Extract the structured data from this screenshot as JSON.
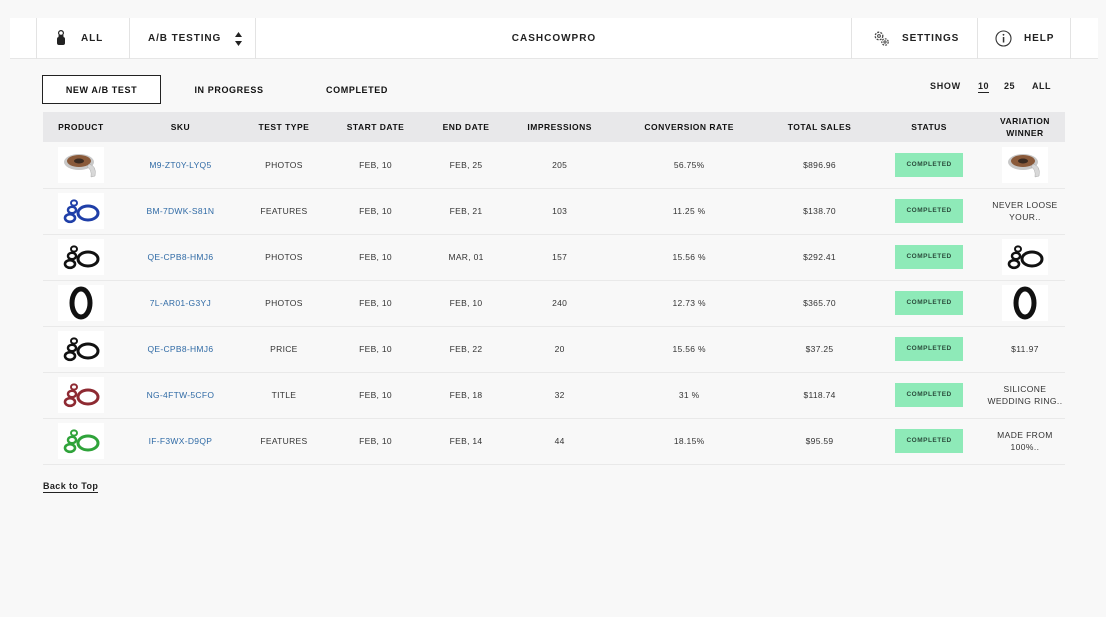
{
  "topbar": {
    "all_label": "ALL",
    "ab_label": "A/B TESTING",
    "title": "CASHCOWPRO",
    "settings_label": "SETTINGS",
    "help_label": "HELP"
  },
  "tabs": [
    "NEW A/B TEST",
    "IN PROGRESS",
    "COMPLETED"
  ],
  "show": {
    "label": "SHOW",
    "options": [
      "10",
      "25",
      "ALL"
    ],
    "selected": "10"
  },
  "table": {
    "headers": {
      "product": "PRODUCT",
      "sku": "SKU",
      "test_type": "TEST TYPE",
      "start_date": "START DATE",
      "end_date": "END DATE",
      "impressions": "IMPRESSIONS",
      "conversion_rate": "CONVERSION RATE",
      "total_sales": "TOTAL SALES",
      "status": "STATUS",
      "variation_winner": "VARIATION WINNER"
    },
    "rows": [
      {
        "product_icon": "tape-roll-icon",
        "sku": "M9-ZT0Y-LYQ5",
        "test_type": "PHOTOS",
        "start_date": "FEB, 10",
        "end_date": "FEB, 25",
        "impressions": "205",
        "conversion_rate": "56.75%",
        "total_sales": "$896.96",
        "status": "COMPLETED",
        "winner": "",
        "winner_icon": "tape-roll-icon"
      },
      {
        "product_icon": "blue-rings-icon",
        "sku": "BM-7DWK-S81N",
        "test_type": "FEATURES",
        "start_date": "FEB, 10",
        "end_date": "FEB, 21",
        "impressions": "103",
        "conversion_rate": "11.25 %",
        "total_sales": "$138.70",
        "status": "COMPLETED",
        "winner": "NEVER LOOSE YOUR.."
      },
      {
        "product_icon": "black-rings-icon",
        "sku": "QE-CPB8-HMJ6",
        "test_type": "PHOTOS",
        "start_date": "FEB, 10",
        "end_date": "MAR, 01",
        "impressions": "157",
        "conversion_rate": "15.56 %",
        "total_sales": "$292.41",
        "status": "COMPLETED",
        "winner": "",
        "winner_icon": "black-rings-icon"
      },
      {
        "product_icon": "black-ring-single-icon",
        "sku": "7L-AR01-G3YJ",
        "test_type": "PHOTOS",
        "start_date": "FEB, 10",
        "end_date": "FEB, 10",
        "impressions": "240",
        "conversion_rate": "12.73 %",
        "total_sales": "$365.70",
        "status": "COMPLETED",
        "winner": "",
        "winner_icon": "black-ring-single-icon"
      },
      {
        "product_icon": "black-rings-icon",
        "sku": "QE-CPB8-HMJ6",
        "test_type": "PRICE",
        "start_date": "FEB, 10",
        "end_date": "FEB, 22",
        "impressions": "20",
        "conversion_rate": "15.56 %",
        "total_sales": "$37.25",
        "status": "COMPLETED",
        "winner": "$11.97"
      },
      {
        "product_icon": "red-rings-icon",
        "sku": "NG-4FTW-5CFO",
        "test_type": "TITLE",
        "start_date": "FEB, 10",
        "end_date": "FEB, 18",
        "impressions": "32",
        "conversion_rate": "31 %",
        "total_sales": "$118.74",
        "status": "COMPLETED",
        "winner": "SILICONE WEDDING RING.."
      },
      {
        "product_icon": "green-rings-icon",
        "sku": "IF-F3WX-D9QP",
        "test_type": "FEATURES",
        "start_date": "FEB, 10",
        "end_date": "FEB, 14",
        "impressions": "44",
        "conversion_rate": "18.15%",
        "total_sales": "$95.59",
        "status": "COMPLETED",
        "winner": "MADE FROM 100%.."
      }
    ]
  },
  "colors": {
    "badge_bg": "#8eeab8",
    "sku_link": "#2f6aa5",
    "blue_ring": "#1f3fa8",
    "red_ring": "#8e2a32",
    "green_ring": "#2fa33a",
    "black_ring": "#111111"
  },
  "back_to_top": "Back to Top"
}
